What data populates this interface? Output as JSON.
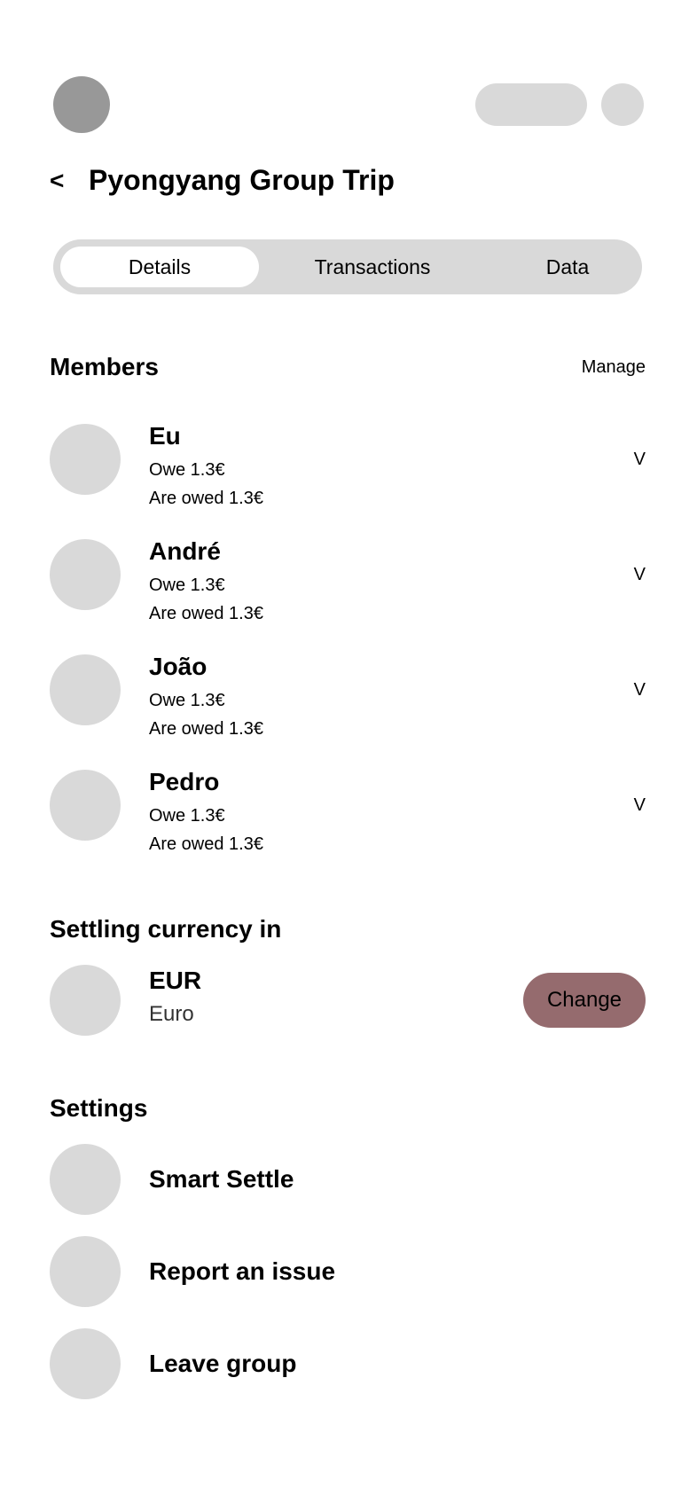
{
  "header": {
    "title": "Pyongyang Group Trip",
    "back_label": "<"
  },
  "tabs": [
    {
      "label": "Details",
      "active": true
    },
    {
      "label": "Transactions",
      "active": false
    },
    {
      "label": "Data",
      "active": false
    }
  ],
  "members": {
    "title": "Members",
    "manage_label": "Manage",
    "items": [
      {
        "name": "Eu",
        "owe": "Owe 1.3€",
        "owed": "Are owed 1.3€",
        "chevron": "V"
      },
      {
        "name": "André",
        "owe": "Owe 1.3€",
        "owed": "Are owed 1.3€",
        "chevron": "V"
      },
      {
        "name": "João",
        "owe": "Owe 1.3€",
        "owed": "Are owed 1.3€",
        "chevron": "V"
      },
      {
        "name": "Pedro",
        "owe": "Owe 1.3€",
        "owed": "Are owed 1.3€",
        "chevron": "V"
      }
    ]
  },
  "currency": {
    "title": "Settling currency in",
    "code": "EUR",
    "name": "Euro",
    "change_label": "Change"
  },
  "settings": {
    "title": "Settings",
    "items": [
      {
        "label": "Smart Settle"
      },
      {
        "label": "Report an issue"
      },
      {
        "label": "Leave group"
      }
    ]
  },
  "colors": {
    "accent_button": "#956b6e",
    "placeholder": "#d9d9d9",
    "avatar": "#989898"
  }
}
